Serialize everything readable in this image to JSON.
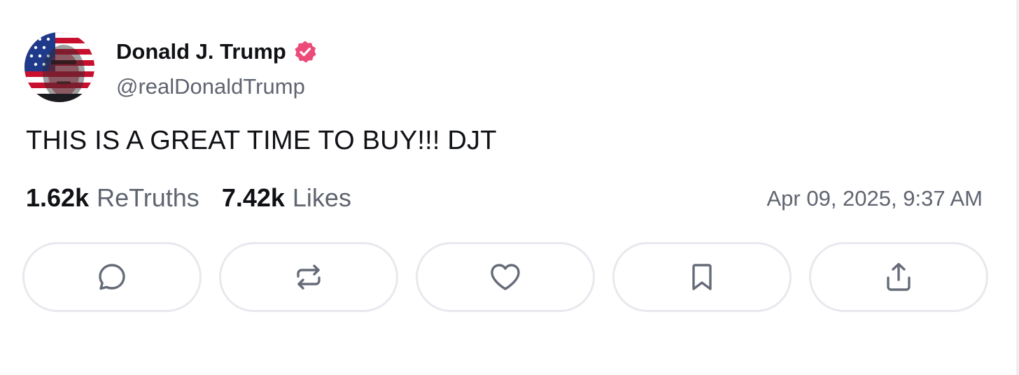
{
  "author": {
    "display_name": "Donald J. Trump",
    "handle": "@realDonaldTrump",
    "verified": true,
    "verified_color": "#ec4b7a",
    "avatar_icon": "avatar-flag-portrait"
  },
  "post": {
    "text": "THIS IS A GREAT TIME TO BUY!!! DJT",
    "timestamp": "Apr 09, 2025, 9:37 AM"
  },
  "stats": {
    "retruths_count": "1.62k",
    "retruths_label": "ReTruths",
    "likes_count": "7.42k",
    "likes_label": "Likes"
  },
  "actions": [
    {
      "name": "reply",
      "icon": "comment-icon"
    },
    {
      "name": "retruth",
      "icon": "repost-icon"
    },
    {
      "name": "like",
      "icon": "heart-icon"
    },
    {
      "name": "bookmark",
      "icon": "bookmark-icon"
    },
    {
      "name": "share",
      "icon": "share-icon"
    }
  ],
  "colors": {
    "text_primary": "#0f1115",
    "text_secondary": "#5f6470",
    "button_border": "#e7e9ee",
    "icon_color": "#656b78"
  }
}
